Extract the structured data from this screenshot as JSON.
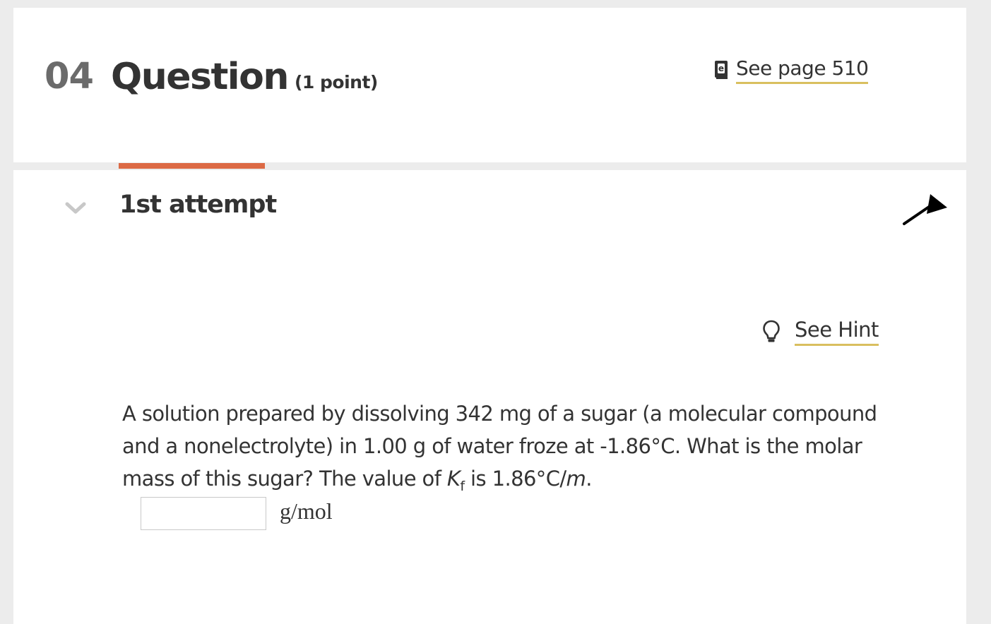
{
  "question": {
    "number": "04",
    "title": "Question",
    "points": "(1 point)",
    "ebook_link": "See page 510"
  },
  "attempt": {
    "label": "1st attempt",
    "hint_link": "See Hint",
    "text_part1": "A solution prepared by dissolving 342  mg of a sugar (a molecular compound and a nonelectrolyte) in 1.00 g of water froze at -1.86°C. What is the molar mass of this sugar? The value of ",
    "kf_symbol": "K",
    "kf_subscript": "f",
    "text_part2": " is 1.86°C/",
    "text_unit_m": "m",
    "text_part3": ".",
    "answer_value": "",
    "answer_placeholder": "",
    "unit": "g/mol"
  },
  "colors": {
    "accent_tab": "#dc6a45",
    "link_underline": "#d9bf5f",
    "background": "#ececec",
    "card": "#ffffff"
  },
  "icons": {
    "ebook": "ebook-icon",
    "chevron": "chevron-down-icon",
    "hint": "lightbulb-icon",
    "cursor": "mouse-cursor-icon"
  }
}
